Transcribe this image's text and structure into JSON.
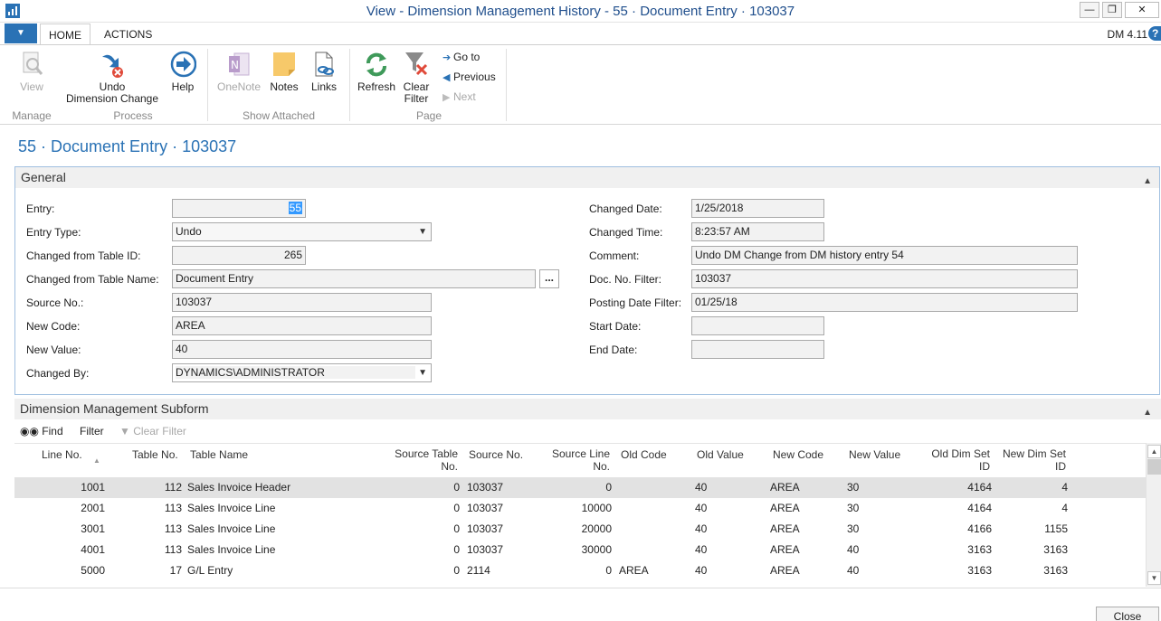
{
  "window": {
    "title": "View - Dimension Management History - 55 · Document Entry · 103037"
  },
  "tabs": {
    "home": "HOME",
    "actions": "ACTIONS",
    "version": "DM 4.11",
    "help_glyph": "?"
  },
  "ribbon": {
    "view": "View",
    "undo_line1": "Undo",
    "undo_line2": "Dimension Change",
    "help": "Help",
    "onenote": "OneNote",
    "notes": "Notes",
    "links": "Links",
    "refresh": "Refresh",
    "clear_filter_line1": "Clear",
    "clear_filter_line2": "Filter",
    "goto": "Go to",
    "previous": "Previous",
    "next": "Next",
    "groups": {
      "manage": "Manage",
      "process": "Process",
      "show_attached": "Show Attached",
      "page": "Page"
    }
  },
  "page_title": "55 · Document Entry · 103037",
  "general": {
    "header": "General",
    "labels": {
      "entry": "Entry:",
      "entry_type": "Entry Type:",
      "changed_from_table_id": "Changed from Table ID:",
      "changed_from_table_name": "Changed from Table Name:",
      "source_no": "Source No.:",
      "new_code": "New Code:",
      "new_value": "New Value:",
      "changed_by": "Changed By:",
      "changed_date": "Changed Date:",
      "changed_time": "Changed Time:",
      "comment": "Comment:",
      "doc_no_filter": "Doc. No. Filter:",
      "posting_date_filter": "Posting Date Filter:",
      "start_date": "Start Date:",
      "end_date": "End Date:"
    },
    "values": {
      "entry": "55",
      "entry_type": "Undo",
      "changed_from_table_id": "265",
      "changed_from_table_name": "Document Entry",
      "source_no": "103037",
      "new_code": "AREA",
      "new_value": "40",
      "changed_by": "DYNAMICS\\ADMINISTRATOR",
      "changed_date": "1/25/2018",
      "changed_time": "8:23:57 AM",
      "comment": "Undo DM Change from DM history entry 54",
      "doc_no_filter": "103037",
      "posting_date_filter": "01/25/18",
      "start_date": "",
      "end_date": ""
    },
    "assist_label": "..."
  },
  "subform": {
    "header": "Dimension Management Subform",
    "find": "Find",
    "filter": "Filter",
    "clear_filter": "Clear Filter",
    "columns": {
      "line_no": "Line No.",
      "table_no": "Table No.",
      "table_name": "Table Name",
      "source_table_no_1": "Source Table",
      "source_table_no_2": "No.",
      "source_no": "Source No.",
      "source_line_no_1": "Source Line",
      "source_line_no_2": "No.",
      "old_code": "Old Code",
      "old_value": "Old Value",
      "new_code": "New Code",
      "new_value": "New Value",
      "old_dim_set_1": "Old Dim Set",
      "old_dim_set_2": "ID",
      "new_dim_set_1": "New Dim Set",
      "new_dim_set_2": "ID"
    },
    "rows": [
      {
        "line_no": "1001",
        "table_no": "112",
        "table_name": "Sales Invoice Header",
        "source_table_no": "0",
        "source_no": "103037",
        "source_line_no": "0",
        "old_code": "",
        "old_value": "40",
        "new_code": "AREA",
        "new_value": "30",
        "old_dim_set": "4164",
        "new_dim_set": "4"
      },
      {
        "line_no": "2001",
        "table_no": "113",
        "table_name": "Sales Invoice Line",
        "source_table_no": "0",
        "source_no": "103037",
        "source_line_no": "10000",
        "old_code": "",
        "old_value": "40",
        "new_code": "AREA",
        "new_value": "30",
        "old_dim_set": "4164",
        "new_dim_set": "4"
      },
      {
        "line_no": "3001",
        "table_no": "113",
        "table_name": "Sales Invoice Line",
        "source_table_no": "0",
        "source_no": "103037",
        "source_line_no": "20000",
        "old_code": "",
        "old_value": "40",
        "new_code": "AREA",
        "new_value": "30",
        "old_dim_set": "4166",
        "new_dim_set": "1155"
      },
      {
        "line_no": "4001",
        "table_no": "113",
        "table_name": "Sales Invoice Line",
        "source_table_no": "0",
        "source_no": "103037",
        "source_line_no": "30000",
        "old_code": "",
        "old_value": "40",
        "new_code": "AREA",
        "new_value": "40",
        "old_dim_set": "3163",
        "new_dim_set": "3163"
      },
      {
        "line_no": "5000",
        "table_no": "17",
        "table_name": "G/L Entry",
        "source_table_no": "0",
        "source_no": "2114",
        "source_line_no": "0",
        "old_code": "AREA",
        "old_value": "40",
        "new_code": "AREA",
        "new_value": "40",
        "old_dim_set": "3163",
        "new_dim_set": "3163"
      }
    ]
  },
  "footer": {
    "close": "Close"
  }
}
